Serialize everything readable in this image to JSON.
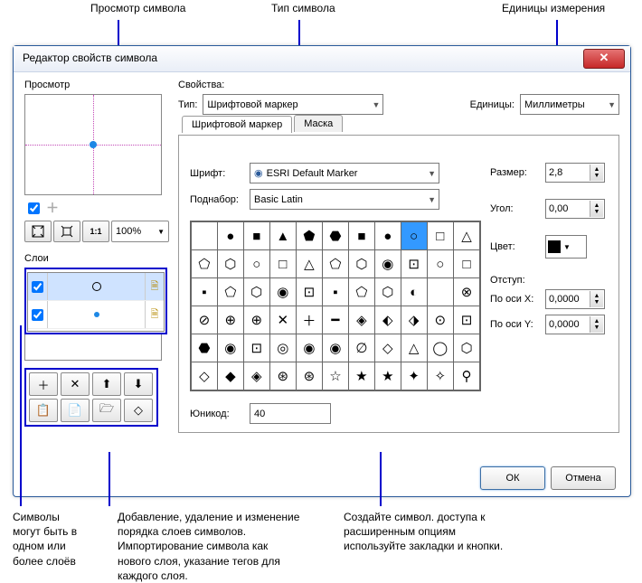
{
  "annotations": {
    "top_preview": "Просмотр символа",
    "top_type": "Тип символа",
    "top_units": "Единицы измерения",
    "bot_layers": "Символы\nмогут быть в\nодном или\nболее слоёв",
    "bot_addremove": "Добавление, удаление и изменение\nпорядка слоев символов.\nИмпортирование символа как\nнового слоя, указание тегов для\nкаждого слоя.",
    "bot_create": "Создайте символ. доступа к\nрасширенным опциям\nиспользуйте закладки и кнопки."
  },
  "dialog": {
    "title": "Редактор свойств символа",
    "preview_label": "Просмотр",
    "zoom": "100%",
    "layers_label": "Слои",
    "properties_label": "Свойства:",
    "type_label": "Тип:",
    "type_value": "Шрифтовой маркер",
    "units_label": "Единицы:",
    "units_value": "Миллиметры",
    "tabs": {
      "marker": "Шрифтовой маркер",
      "mask": "Маска"
    },
    "font_label": "Шрифт:",
    "font_value": "ESRI Default Marker",
    "subset_label": "Поднабор:",
    "subset_value": "Basic Latin",
    "unicode_label": "Юникод:",
    "unicode_value": "40",
    "size_label": "Размер:",
    "size_value": "2,8",
    "angle_label": "Угол:",
    "angle_value": "0,00",
    "color_label": "Цвет:",
    "offset_label": "Отступ:",
    "offset_x_label": "По оси X:",
    "offset_x_value": "0,0000",
    "offset_y_label": "По оси Y:",
    "offset_y_value": "0,0000",
    "ok": "ОК",
    "cancel": "Отмена"
  },
  "glyphs": [
    [
      "",
      "●",
      "■",
      "▲",
      "⬟",
      "⬣",
      "■",
      "●",
      "○",
      "□",
      "△"
    ],
    [
      "⬠",
      "⬡",
      "○",
      "□",
      "△",
      "⬠",
      "⬡",
      "◉",
      "⊡",
      "○",
      "□"
    ],
    [
      "▪",
      "⬠",
      "⬡",
      "◉",
      "⊡",
      "▪",
      "⬠",
      "⬡",
      "◐",
      "",
      "⊗"
    ],
    [
      "⊘",
      "⊕",
      "⊕",
      "✕",
      "＋",
      "━",
      "◈",
      "⬖",
      "⬗",
      "⊙",
      "⊡"
    ],
    [
      "⬣",
      "◉",
      "⊡",
      "◎",
      "◉",
      "◉",
      "∅",
      "◇",
      "△",
      "◯",
      "⬡"
    ],
    [
      "◇",
      "◆",
      "◈",
      "⊛",
      "⊛",
      "☆",
      "★",
      "★",
      "✦",
      "✧",
      "⚲"
    ]
  ],
  "glyph_selected": {
    "row": 0,
    "col": 8
  }
}
